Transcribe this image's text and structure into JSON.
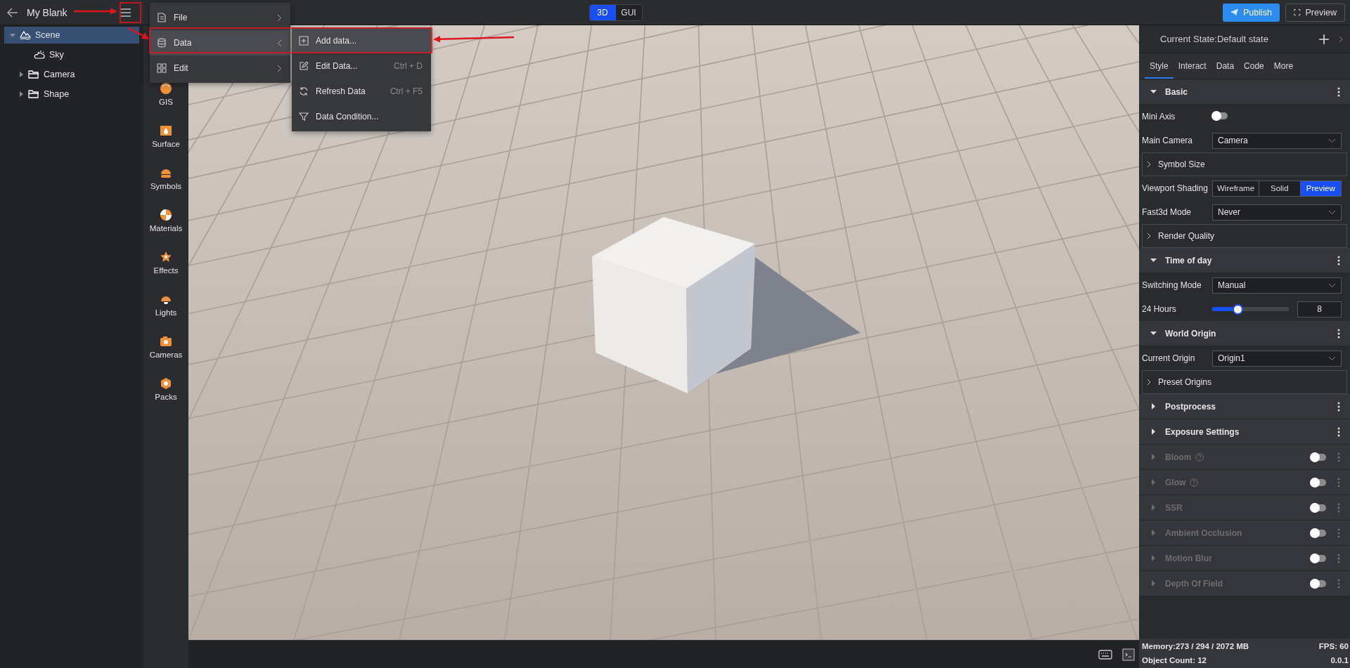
{
  "project": {
    "title": "My Blank"
  },
  "view_modes": [
    {
      "label": "3D",
      "selected": true
    },
    {
      "label": "GUI",
      "selected": false
    }
  ],
  "header_buttons": [
    {
      "label": "Publish",
      "kind": "primary"
    },
    {
      "label": "Preview",
      "kind": "outline"
    }
  ],
  "scene_tree": [
    {
      "label": "Scene",
      "kind": "scene",
      "selected": true,
      "expanded": true,
      "children": [
        {
          "label": "Sky",
          "kind": "sky",
          "selected": false
        },
        {
          "label": "Camera",
          "kind": "folder",
          "selected": false,
          "expanded": false
        },
        {
          "label": "Shape",
          "kind": "folder",
          "selected": false,
          "expanded": false
        }
      ]
    }
  ],
  "toolbox": [
    {
      "label": "GIS"
    },
    {
      "label": "Surface"
    },
    {
      "label": "Symbols"
    },
    {
      "label": "Materials"
    },
    {
      "label": "Effects"
    },
    {
      "label": "Lights"
    },
    {
      "label": "Cameras"
    },
    {
      "label": "Packs"
    }
  ],
  "main_menu": [
    {
      "label": "File",
      "selected": false
    },
    {
      "label": "Data",
      "selected": true
    },
    {
      "label": "Edit",
      "selected": false
    }
  ],
  "submenu": [
    {
      "label": "Add data...",
      "selected": true
    },
    {
      "label": "Edit Data...",
      "shortcut": "Ctrl + D",
      "selected": false
    },
    {
      "label": "Refresh Data",
      "shortcut": "Ctrl + F5",
      "selected": false
    },
    {
      "label": "Data Condition...",
      "selected": false
    }
  ],
  "properties": {
    "state": "Current State:Default state",
    "tabs": [
      {
        "label": "Style",
        "selected": true
      },
      {
        "label": "Interact",
        "selected": false
      },
      {
        "label": "Data",
        "selected": false
      },
      {
        "label": "Code",
        "selected": false
      },
      {
        "label": "More",
        "selected": false
      }
    ],
    "sections": [
      {
        "title": "Basic",
        "expanded": true,
        "rows": [
          {
            "kind": "toggle",
            "label": "Mini Axis",
            "on": false
          },
          {
            "kind": "select",
            "label": "Main Camera",
            "value": "Camera"
          },
          {
            "kind": "group",
            "label": "Symbol Size"
          },
          {
            "kind": "segmented",
            "label": "Viewport Shading",
            "options": [
              {
                "label": "Wireframe",
                "selected": false
              },
              {
                "label": "Solid",
                "selected": false
              },
              {
                "label": "Preview",
                "selected": true
              }
            ]
          },
          {
            "kind": "select",
            "label": "Fast3d Mode",
            "value": "Never"
          },
          {
            "kind": "group",
            "label": "Render Quality"
          }
        ]
      },
      {
        "title": "Time of day",
        "expanded": true,
        "rows": [
          {
            "kind": "select",
            "label": "Switching Mode",
            "value": "Manual"
          },
          {
            "kind": "slider",
            "label": "24 Hours",
            "level": 0.33,
            "value": "8"
          }
        ]
      },
      {
        "title": "World Origin",
        "expanded": true,
        "rows": [
          {
            "kind": "select",
            "label": "Current Origin",
            "value": "Origin1"
          },
          {
            "kind": "group",
            "label": "Preset Origins"
          }
        ]
      },
      {
        "title": "Postprocess",
        "expanded": false
      },
      {
        "title": "Exposure Settings",
        "expanded": false
      },
      {
        "title": "Bloom",
        "expanded": false,
        "disabled": true,
        "help": true,
        "on": false
      },
      {
        "title": "Glow",
        "expanded": false,
        "disabled": true,
        "help": true,
        "on": false
      },
      {
        "title": "SSR",
        "expanded": false,
        "disabled": true,
        "on": false
      },
      {
        "title": "Ambient Occlusion",
        "expanded": false,
        "disabled": true,
        "on": false
      },
      {
        "title": "Motion Blur",
        "expanded": false,
        "disabled": true,
        "on": false
      },
      {
        "title": "Depth Of Field",
        "expanded": false,
        "disabled": true,
        "on": false
      }
    ]
  },
  "status": {
    "memory": "Memory:273 / 294 / 2072 MB",
    "fps": "FPS: 60",
    "object_count": "Object Count: 12",
    "version": "0.0.1"
  }
}
